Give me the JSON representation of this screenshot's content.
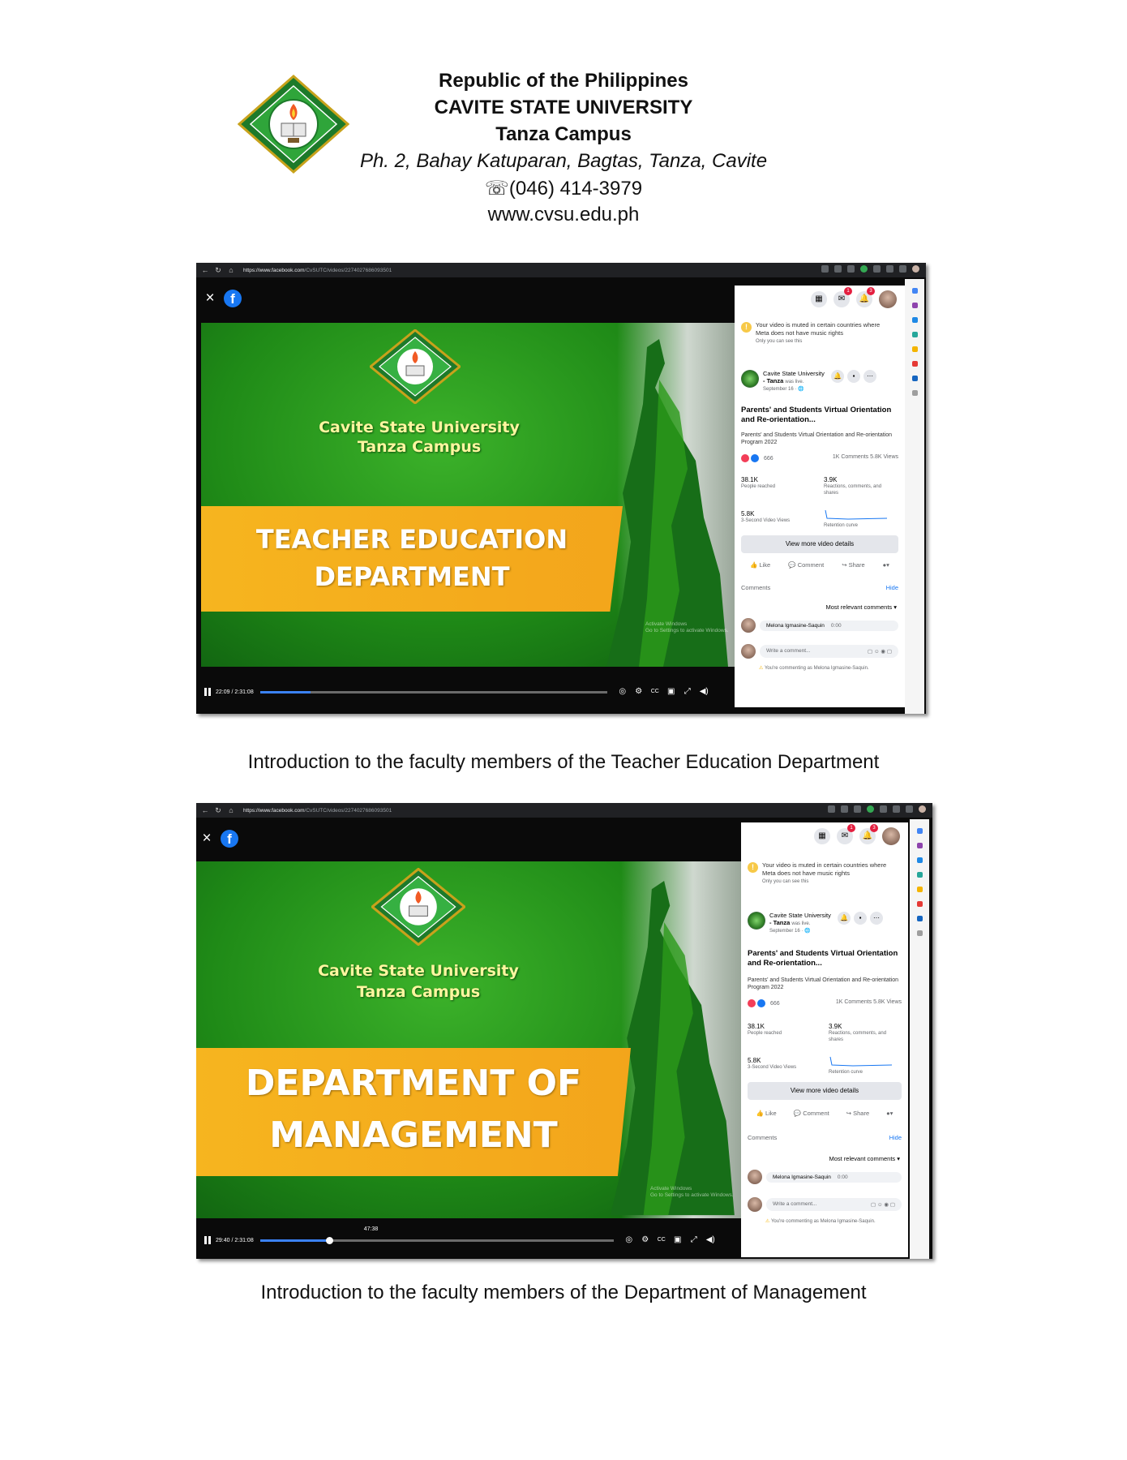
{
  "letterhead": {
    "country": "Republic of the Philippines",
    "university": "CAVITE STATE UNIVERSITY",
    "campus": "Tanza Campus",
    "address": "Ph. 2, Bahay Katuparan, Bagtas, Tanza, Cavite",
    "phone": "☏(046) 414-3979",
    "website": "www.cvsu.edu.ph"
  },
  "screenshots": [
    {
      "url_host": "https://www.facebook.com",
      "url_path": "/CvSUTC/videos/2274027686093501",
      "video": {
        "university": "Cavite State University",
        "campus": "Tanza Campus",
        "banner_line1": "TEACHER EDUCATION",
        "banner_line2": "DEPARTMENT",
        "activate_line1": "Activate Windows",
        "activate_line2": "Go to Settings to activate Windows.",
        "time": "22:09 / 2:31:08",
        "progress_fraction": 0.146
      },
      "caption": "Introduction to the faculty members of the Teacher Education Department"
    },
    {
      "url_host": "https://www.facebook.com",
      "url_path": "/CvSUTC/videos/2274027686093501",
      "video": {
        "university": "Cavite State University",
        "campus": "Tanza Campus",
        "banner_line1": "DEPARTMENT OF",
        "banner_line2": "MANAGEMENT",
        "activate_line1": "Activate Windows",
        "activate_line2": "Go to Settings to activate Windows.",
        "time": "29:40 / 2:31:08",
        "hover_time": "47:38",
        "progress_fraction": 0.196
      },
      "caption": "Introduction to the faculty members of the Department of Management"
    }
  ],
  "panel": {
    "notice_line1": "Your video is muted in certain countries where",
    "notice_line2": "Meta does not have music rights",
    "notice_only": "Only you can see this",
    "page_name": "Cavite State University",
    "page_sub1": "- Tanza",
    "page_sub2": "was live.",
    "page_date": "September 16 · 🌐",
    "post_title": "Parents' and Students Virtual Orientation and Re-orientation...",
    "post_desc": "Parents' and Students Virtual Orientation and Re-orientation Program 2022",
    "reactions": "666",
    "comments_views": "1K Comments  5.8K Views",
    "stat1_value": "38.1K",
    "stat1_label": "People reached",
    "stat2_value": "3.9K",
    "stat2_label": "Reactions, comments, and shares",
    "stat3_value": "5.8K",
    "stat3_label": "3-Second Video Views",
    "stat4_label": "Retention curve",
    "view_more": "View more video details",
    "like": "Like",
    "comment": "Comment",
    "share": "Share",
    "comments_header": "Comments",
    "hide": "Hide",
    "sort": "Most relevant comments ▾",
    "commenter": "Melona Igmasine-Saquin",
    "comment_time": "0:00",
    "write_placeholder": "Write a comment...",
    "commenting_as": "You're commenting as Melona Igmasine-Saquin.",
    "badge1": "1",
    "badge2": "3"
  },
  "icons": {
    "back": "←",
    "reload": "↻",
    "home": "⌂",
    "close": "×",
    "pause": "pause-icon",
    "settings": "⚙",
    "cc": "CC",
    "fullscreen": "⤢",
    "volume": "🔊"
  },
  "colors": {
    "video_green": "#2c9a1a",
    "banner_orange": "#f4ae1d",
    "video_title_yellow": "#fff6a0",
    "facebook_blue": "#1877f2"
  }
}
